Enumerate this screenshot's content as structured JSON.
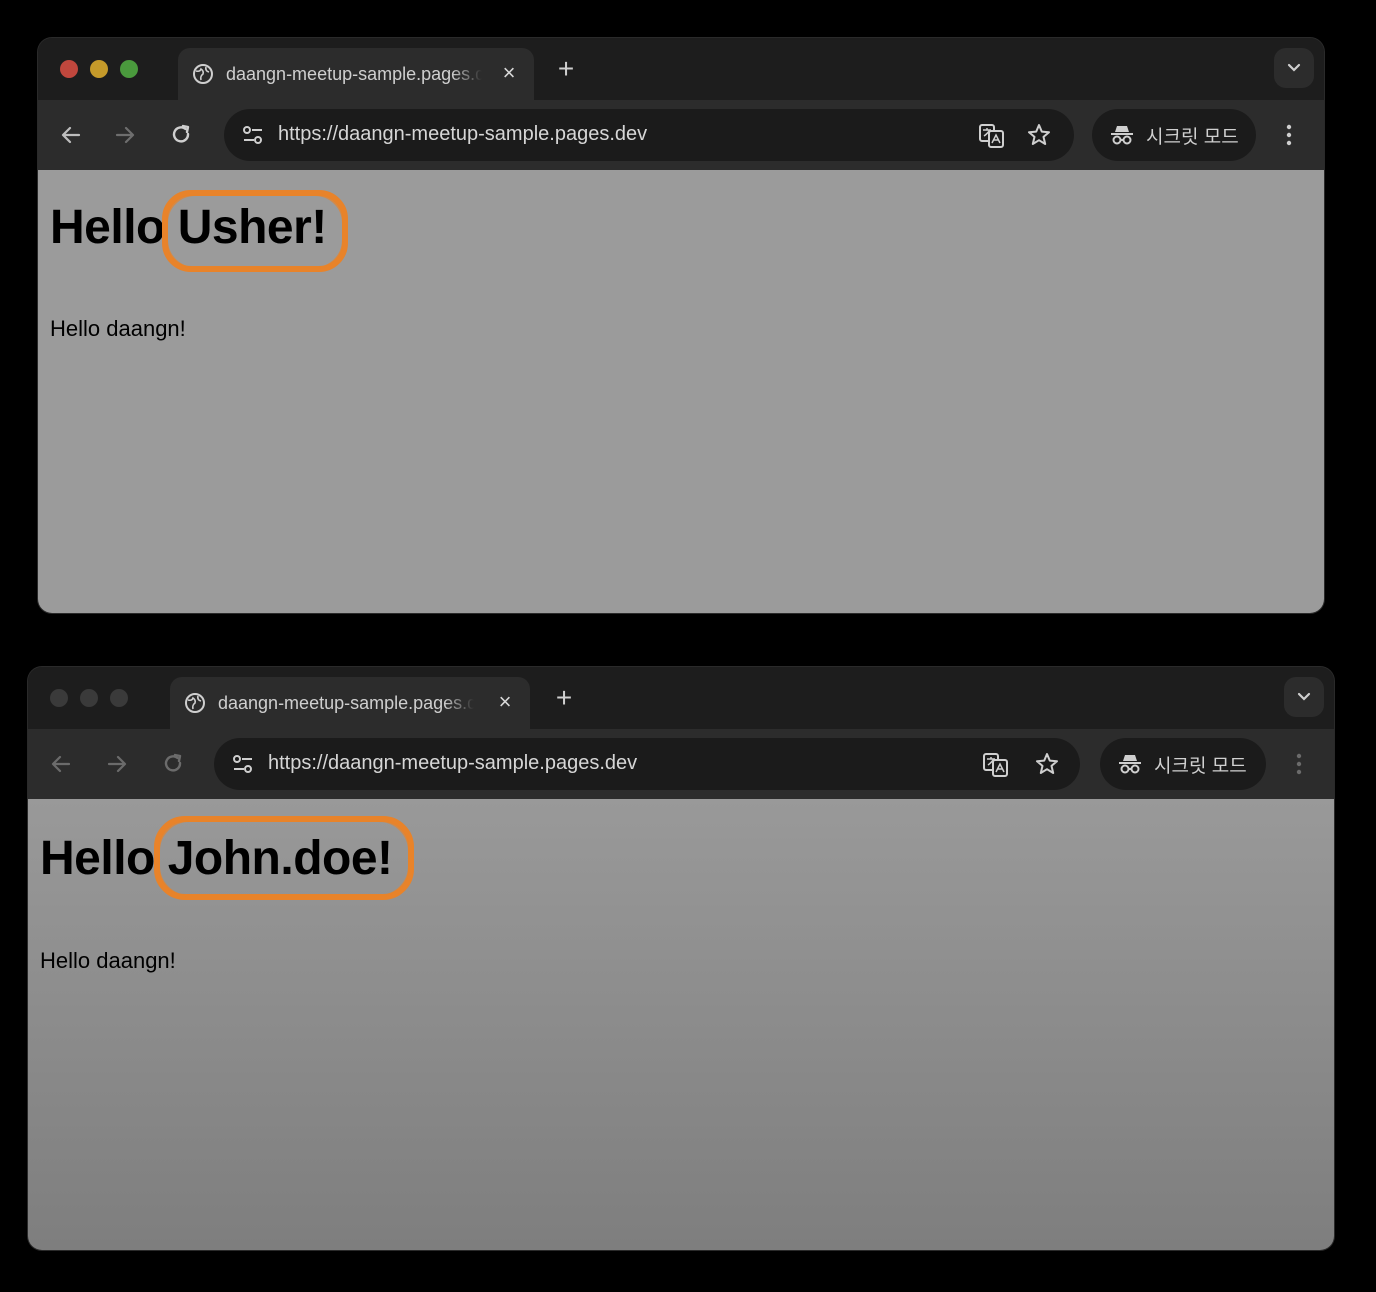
{
  "windows": [
    {
      "tab_title": "daangn-meetup-sample.pages.dev",
      "new_tab_symbol": "+",
      "close_symbol": "×",
      "url": "https://daangn-meetup-sample.pages.dev",
      "incognito_label": "시크릿 모드",
      "heading_prefix": "Hello",
      "heading_name": "Usher!",
      "paragraph": "Hello daangn!",
      "traffic_lights_active": true
    },
    {
      "tab_title": "daangn-meetup-sample.pages.dev",
      "new_tab_symbol": "+",
      "close_symbol": "×",
      "url": "https://daangn-meetup-sample.pages.dev",
      "incognito_label": "시크릿 모드",
      "heading_prefix": "Hello",
      "heading_name": "John.doe!",
      "paragraph": "Hello daangn!",
      "traffic_lights_active": false
    }
  ],
  "colors": {
    "highlight_circle": "#e8832a",
    "page_background": "#9b9b9b",
    "window_chrome": "#2c2c2c"
  },
  "icons": [
    "globe-icon",
    "close-icon",
    "plus-icon",
    "chevron-down-icon",
    "back-arrow-icon",
    "forward-arrow-icon",
    "reload-icon",
    "site-settings-icon",
    "translate-icon",
    "star-icon",
    "incognito-icon",
    "more-menu-icon"
  ]
}
